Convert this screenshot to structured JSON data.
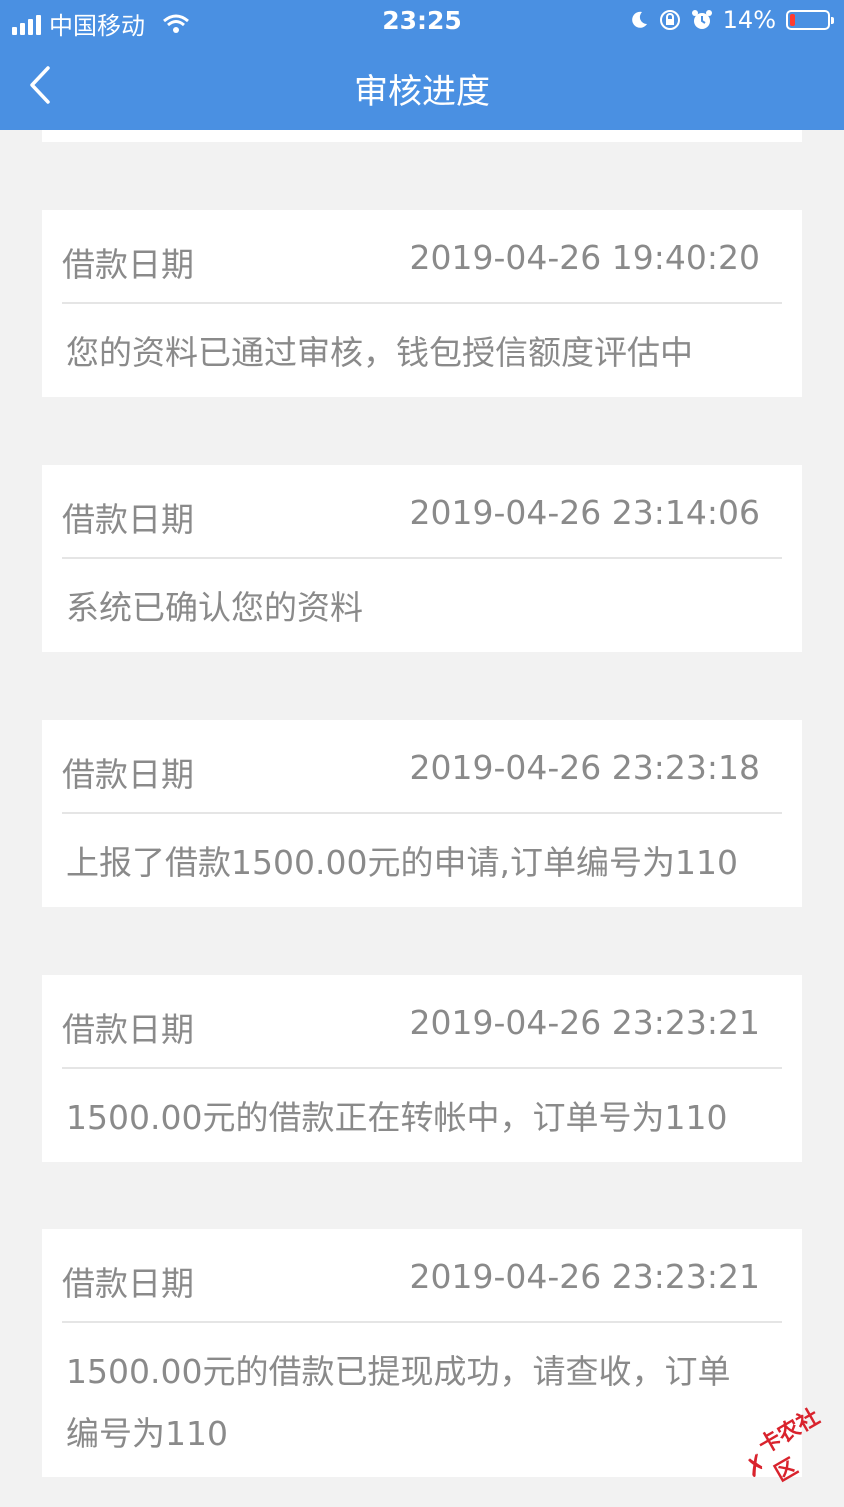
{
  "status_bar": {
    "carrier": "中国移动",
    "time": "23:25",
    "battery_percent": "14%",
    "battery_level": 0.14
  },
  "nav": {
    "title": "审核进度"
  },
  "records": [
    {
      "label": "借款日期",
      "date": "2019-04-26 19:40:20",
      "message": "您的资料已通过审核，钱包授信额度评估中"
    },
    {
      "label": "借款日期",
      "date": "2019-04-26 23:14:06",
      "message": "系统已确认您的资料"
    },
    {
      "label": "借款日期",
      "date": "2019-04-26 23:23:18",
      "message": "上报了借款1500.00元的申请,订单编号为110"
    },
    {
      "label": "借款日期",
      "date": "2019-04-26 23:23:21",
      "message": "1500.00元的借款正在转帐中，订单号为110"
    },
    {
      "label": "借款日期",
      "date": "2019-04-26 23:23:21",
      "message": "1500.00元的借款已提现成功，请查收，订单编号为110"
    }
  ],
  "watermark": {
    "text": "卡农社区"
  },
  "colors": {
    "header": "#4a90e2",
    "background": "#f2f2f2",
    "card": "#ffffff",
    "text_gray": "#8a8a8a",
    "battery_low": "#ff3b30"
  }
}
